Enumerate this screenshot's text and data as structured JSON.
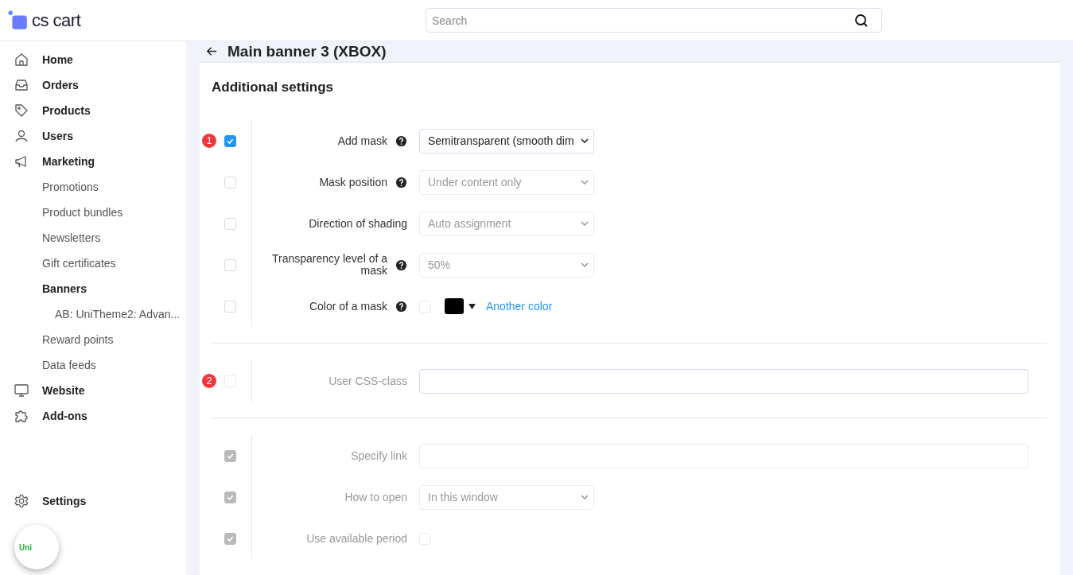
{
  "header": {
    "logo": "cs cart",
    "search": {
      "placeholder": "Search"
    }
  },
  "sidebar": {
    "items": [
      {
        "label": "Home"
      },
      {
        "label": "Orders"
      },
      {
        "label": "Products"
      },
      {
        "label": "Users"
      },
      {
        "label": "Marketing",
        "children": [
          {
            "label": "Promotions",
            "selected": false
          },
          {
            "label": "Product bundles",
            "selected": false
          },
          {
            "label": "Newsletters",
            "selected": false
          },
          {
            "label": "Gift certificates",
            "selected": false
          },
          {
            "label": "Banners",
            "selected": true,
            "children": [
              {
                "label": "AB: UniTheme2: Advan...",
                "selected": false
              }
            ]
          },
          {
            "label": "Reward points",
            "selected": false
          },
          {
            "label": "Data feeds",
            "selected": false
          }
        ]
      },
      {
        "label": "Website"
      },
      {
        "label": "Add-ons"
      }
    ],
    "footer_item": {
      "label": "Settings"
    },
    "widget_button": {
      "label": "Uni"
    }
  },
  "page": {
    "title": "Main banner 3 (XBOX)",
    "section_title": "Additional settings",
    "groups": [
      {
        "rows": [
          {
            "badge": "1",
            "checked": true,
            "disabled": false,
            "label": "Add mask",
            "help": true,
            "control": {
              "kind": "select",
              "value": "Semitransparent (smooth dim",
              "disabled": false
            }
          },
          {
            "checked": false,
            "disabled": false,
            "label": "Mask position",
            "help": true,
            "control": {
              "kind": "select",
              "value": "Under content only",
              "disabled": true
            }
          },
          {
            "checked": false,
            "disabled": false,
            "label": "Direction of shading",
            "help": false,
            "control": {
              "kind": "select",
              "value": "Auto assignment",
              "disabled": true
            }
          },
          {
            "checked": false,
            "disabled": false,
            "label": "Transparency level of a mask",
            "help": true,
            "control": {
              "kind": "select",
              "value": "50%",
              "disabled": true
            }
          },
          {
            "checked": false,
            "disabled": false,
            "label": "Color of a mask",
            "help": true,
            "control": {
              "kind": "color",
              "checked": false,
              "color": "#000000",
              "link": "Another color"
            }
          }
        ]
      },
      {
        "rows": [
          {
            "badge": "2",
            "checked": false,
            "disabled": true,
            "label": "User CSS-class",
            "help": false,
            "control": {
              "kind": "input",
              "disabled": false
            }
          }
        ]
      },
      {
        "rows": [
          {
            "checked": true,
            "disabled": true,
            "label": "Specify link",
            "help": false,
            "control": {
              "kind": "input",
              "disabled": true
            }
          },
          {
            "checked": true,
            "disabled": true,
            "label": "How to open",
            "help": false,
            "control": {
              "kind": "select",
              "value": "In this window",
              "disabled": true
            }
          },
          {
            "checked": true,
            "disabled": true,
            "label": "Use available period",
            "help": false,
            "control": {
              "kind": "checkbox",
              "checked": false
            }
          }
        ]
      }
    ]
  }
}
